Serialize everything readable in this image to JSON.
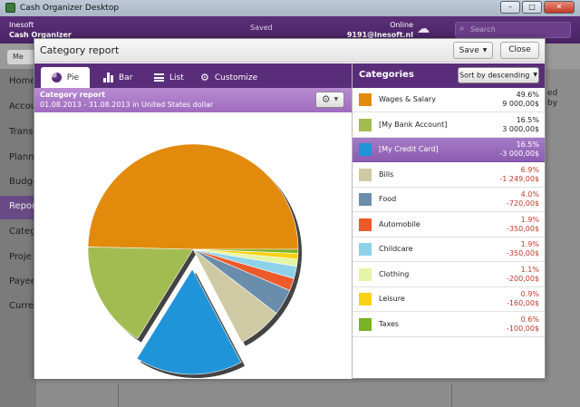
{
  "os_window": {
    "title": "Cash Organizer Desktop"
  },
  "app_header": {
    "company": "Inesoft",
    "product": "Cash Organizer",
    "status": "Saved",
    "online_label": "Online",
    "account": "9191@inesoft.nl",
    "search_placeholder": "Search"
  },
  "background": {
    "menu_label": "Me",
    "sidebar_items": [
      "Home",
      "Accou",
      "Transa",
      "Plann",
      "Budge",
      "Repor",
      "Categ",
      "Proje",
      "Payee",
      "Curre"
    ],
    "right_text": "ed\nby"
  },
  "dialog": {
    "title": "Category report",
    "save_label": "Save",
    "close_label": "Close",
    "tabs": [
      {
        "label": "Pie",
        "icon": "pie-icon"
      },
      {
        "label": "Bar",
        "icon": "bar-chart-icon"
      },
      {
        "label": "List",
        "icon": "list-icon"
      },
      {
        "label": "Customize",
        "icon": "gear-icon"
      }
    ],
    "report_title": "Category report",
    "report_period": "01.08.2013 - 31.08.2013 in United States dollar",
    "categories_title": "Categories",
    "sort_label": "Sort by descending"
  },
  "categories": [
    {
      "name": "Wages & Salary",
      "percent": "49.6%",
      "amount": "9 000,00$",
      "color": "#e28a0b",
      "negative": false
    },
    {
      "name": "[My Bank Account]",
      "percent": "16.5%",
      "amount": "3 000,00$",
      "color": "#a2bc52",
      "negative": false
    },
    {
      "name": "[My Credit Card]",
      "percent": "16.5%",
      "amount": "-3 000,00$",
      "color": "#1f94d9",
      "negative": true,
      "selected": true
    },
    {
      "name": "Bills",
      "percent": "6.9%",
      "amount": "-1 249,00$",
      "color": "#cfcaa4",
      "negative": true
    },
    {
      "name": "Food",
      "percent": "4.0%",
      "amount": "-720,00$",
      "color": "#6a8dab",
      "negative": true
    },
    {
      "name": "Automobile",
      "percent": "1.9%",
      "amount": "-350,00$",
      "color": "#ec5a2a",
      "negative": true
    },
    {
      "name": "Childcare",
      "percent": "1.9%",
      "amount": "-350,00$",
      "color": "#8ed2ea",
      "negative": true
    },
    {
      "name": "Clothing",
      "percent": "1.1%",
      "amount": "-200,00$",
      "color": "#e4f5a5",
      "negative": true
    },
    {
      "name": "Leisure",
      "percent": "0.9%",
      "amount": "-160,00$",
      "color": "#f8d214",
      "negative": true
    },
    {
      "name": "Taxes",
      "percent": "0.6%",
      "amount": "-100,00$",
      "color": "#7bb124",
      "negative": true
    }
  ],
  "chart_data": {
    "type": "pie",
    "categories": [
      "Wages & Salary",
      "[My Bank Account]",
      "[My Credit Card]",
      "Bills",
      "Food",
      "Automobile",
      "Childcare",
      "Clothing",
      "Leisure",
      "Taxes"
    ],
    "values": [
      49.6,
      16.5,
      16.5,
      6.9,
      4.0,
      1.9,
      1.9,
      1.1,
      0.9,
      0.6
    ],
    "amounts": [
      9000.0,
      3000.0,
      -3000.0,
      -1249.0,
      -720.0,
      -350.0,
      -350.0,
      -200.0,
      -160.0,
      -100.0
    ],
    "exploded": "[My Credit Card]",
    "colors": [
      "#e28a0b",
      "#a2bc52",
      "#1f94d9",
      "#cfcaa4",
      "#6a8dab",
      "#ec5a2a",
      "#8ed2ea",
      "#e4f5a5",
      "#f8d214",
      "#7bb124"
    ],
    "title": "",
    "legend": "right"
  }
}
